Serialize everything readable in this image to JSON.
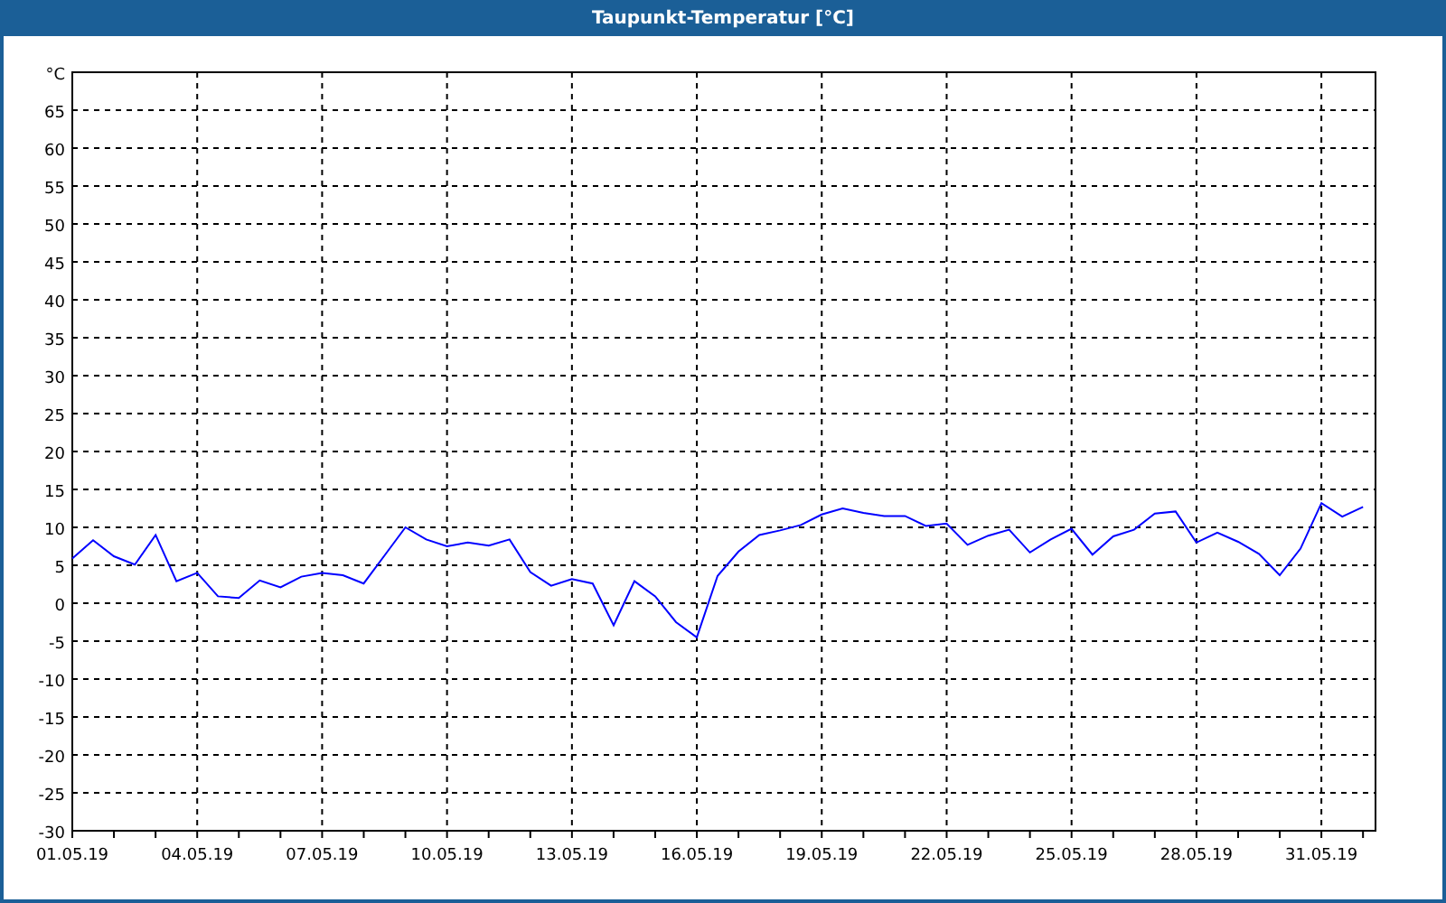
{
  "window": {
    "title": "Taupunkt-Temperatur [°C]"
  },
  "chart_data": {
    "type": "line",
    "ylabel": "°C",
    "grid": true,
    "ylim": [
      -30,
      70
    ],
    "yticks": [
      -30,
      -25,
      -20,
      -15,
      -10,
      -5,
      0,
      5,
      10,
      15,
      20,
      25,
      30,
      35,
      40,
      45,
      50,
      55,
      60,
      65
    ],
    "categories": [
      "01.05.19",
      null,
      null,
      null,
      null,
      null,
      "04.05.19",
      null,
      null,
      null,
      null,
      null,
      "07.05.19",
      null,
      null,
      null,
      null,
      null,
      "10.05.19",
      null,
      null,
      null,
      null,
      null,
      "13.05.19",
      null,
      null,
      null,
      null,
      null,
      "16.05.19",
      null,
      null,
      null,
      null,
      null,
      "19.05.19",
      null,
      null,
      null,
      null,
      null,
      "22.05.19",
      null,
      null,
      null,
      null,
      null,
      "25.05.19",
      null,
      null,
      null,
      null,
      null,
      "28.05.19",
      null,
      null,
      null,
      null,
      null,
      "31.05.19",
      null,
      null
    ],
    "series": [
      {
        "color": "#0000ff",
        "values": [
          5.9,
          8.3,
          6.2,
          5.1,
          9.0,
          2.9,
          4,
          0.9,
          0.7,
          3,
          2.1,
          3.5,
          4,
          3.7,
          2.6,
          6.3,
          10,
          8.4,
          7.5,
          8,
          7.6,
          8.4,
          4.1,
          2.3,
          3.2,
          2.6,
          -2.9,
          2.9,
          0.9,
          -2.5,
          -4.5,
          3.6,
          6.8,
          9,
          9.6,
          10.3,
          11.7,
          12.5,
          11.9,
          11.5,
          11.5,
          10.2,
          10.5,
          7.7,
          8.9,
          9.7,
          6.7,
          8.4,
          9.8,
          6.4,
          8.8,
          9.7,
          11.8,
          12.1,
          8,
          9.3,
          8.1,
          6.5,
          3.7,
          7.2,
          13.2,
          11.4,
          12.7
        ]
      }
    ]
  }
}
